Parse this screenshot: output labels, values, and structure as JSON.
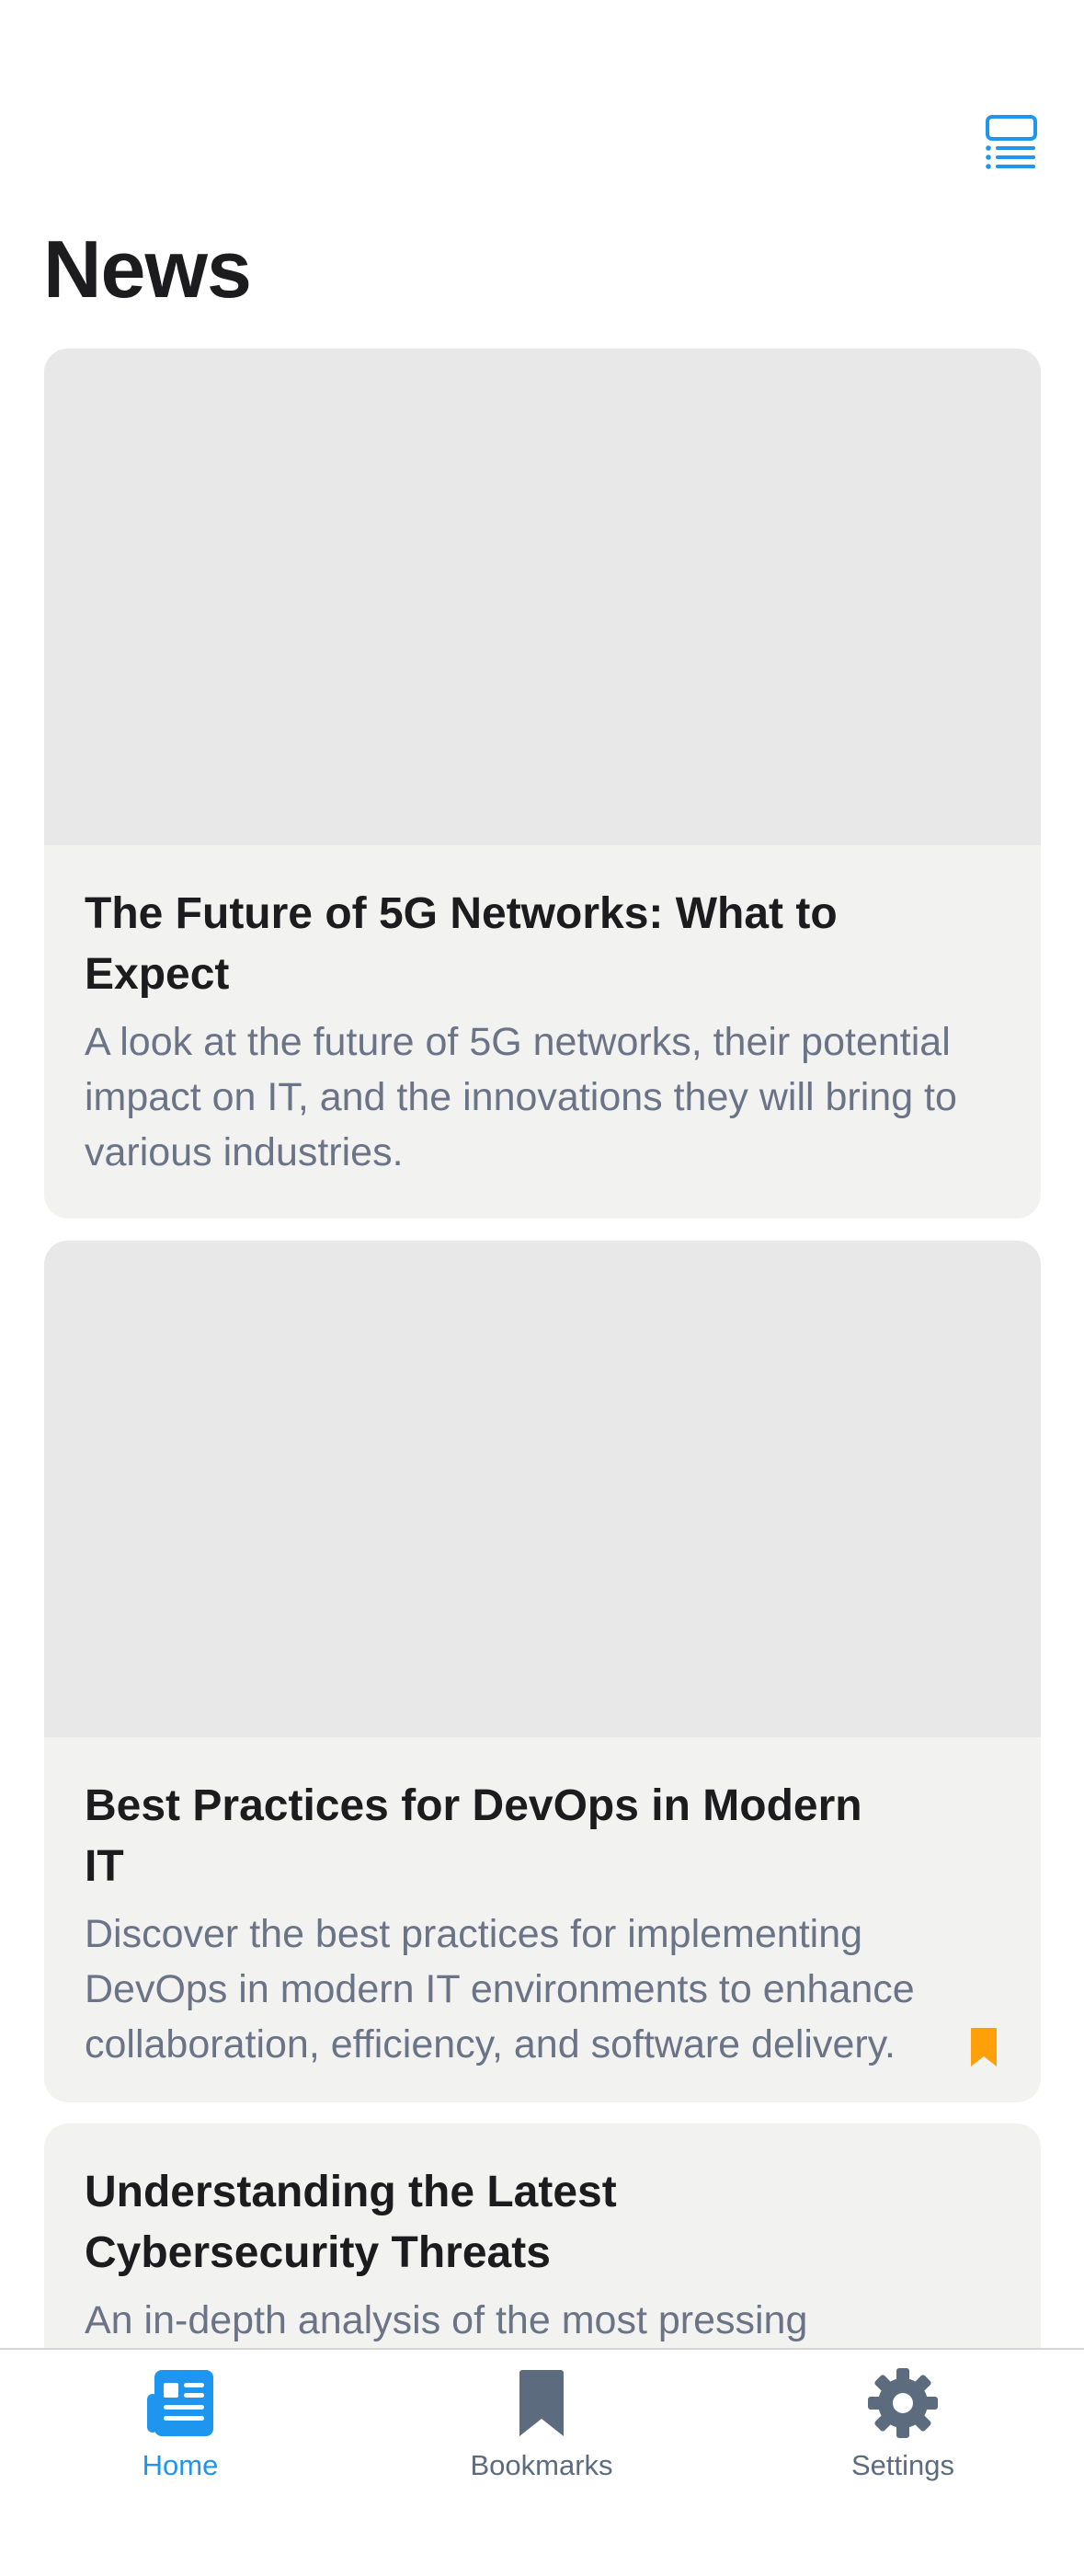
{
  "header": {
    "title": "News",
    "layout_toggle_icon": "list-layout-icon"
  },
  "articles": [
    {
      "title": "The Future of 5G Networks: What to Expect",
      "description": "A look at the future of 5G networks, their potential impact on IT, and the innovations they will bring to various industries.",
      "bookmarked": false
    },
    {
      "title": "Best Practices for DevOps in Modern IT",
      "description": "Discover the best practices for implementing DevOps in modern IT environments to enhance collaboration, efficiency, and software delivery.",
      "bookmarked": true
    },
    {
      "title": "Understanding the Latest Cybersecurity Threats",
      "description": "An in-depth analysis of the most pressing",
      "bookmarked": false
    }
  ],
  "tabbar": {
    "tabs": [
      {
        "label": "Home",
        "icon": "newspaper-icon",
        "active": true
      },
      {
        "label": "Bookmarks",
        "icon": "bookmark-icon",
        "active": false
      },
      {
        "label": "Settings",
        "icon": "gear-icon",
        "active": false
      }
    ]
  },
  "colors": {
    "accent": "#1e96f0",
    "bookmark": "#ff9f0a",
    "inactive": "#5d6b7e",
    "card_background": "#f2f2f1",
    "image_placeholder": "#e8e8e8"
  }
}
